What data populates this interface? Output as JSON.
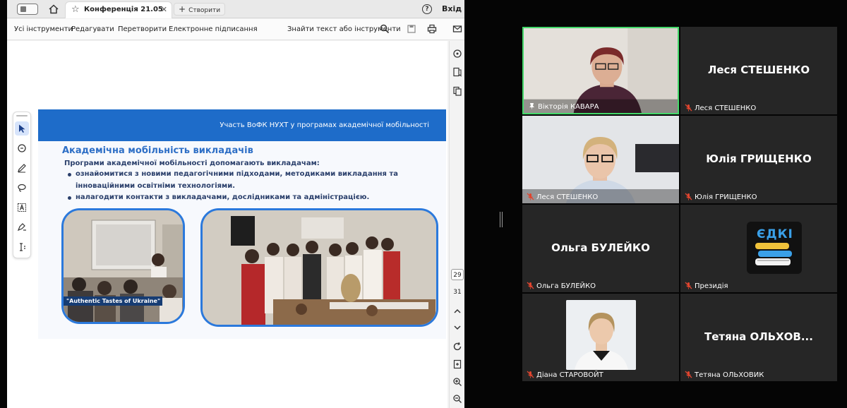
{
  "acrobat": {
    "tab_title": "Конференція 21.05",
    "new_tab_label": "Створити",
    "signin_label": "Вхід",
    "menu": [
      "Усі інструменти",
      "Редагувати",
      "Перетворити",
      "Електронне підписання"
    ],
    "search_label": "Знайти текст або інструменти",
    "pages": [
      "29",
      "31"
    ]
  },
  "slide": {
    "header": "Участь ВоФК НУХТ у програмах академічної мобільності",
    "title": "Академічна мобільність викладачів",
    "intro": "Програми академічної мобільності допомагають викладачам:",
    "bullets": [
      "ознайомитися з новими педагогічними підходами, методиками викладання та",
      "інноваційними освітніми технологіями.",
      "налагодити контакти з викладачами, дослідниками та адміністрацією."
    ],
    "photo_caption": "\"Authentic Tastes of Ukraine\""
  },
  "meeting": {
    "tiles": [
      {
        "label": "Вікторія КАВАРА",
        "big": "",
        "speaking": true
      },
      {
        "label": "Леся СТЕШЕНКО",
        "big": "Леся СТЕШЕНКО"
      },
      {
        "label": "Леся СТЕШЕНКО",
        "big": ""
      },
      {
        "label": "Юлія ГРИЩЕНКО",
        "big": "Юлія ГРИЩЕНКО"
      },
      {
        "label": "Ольга БУЛЕЙКО",
        "big": "Ольга БУЛЕЙКО"
      },
      {
        "label": "Президія",
        "big": "",
        "logo": "ЄДКІ"
      },
      {
        "label": "Діана СТАРОВОЙТ",
        "big": ""
      },
      {
        "label": "Тетяна ОЛЬХОВИК",
        "big": "Тетяна  ОЛЬХОВ..."
      }
    ]
  },
  "colors": {
    "slide_blue": "#1e6cc9",
    "speaking_border": "#44d86a",
    "tile_bg": "#262626",
    "muted_mic": "#e0452f"
  }
}
